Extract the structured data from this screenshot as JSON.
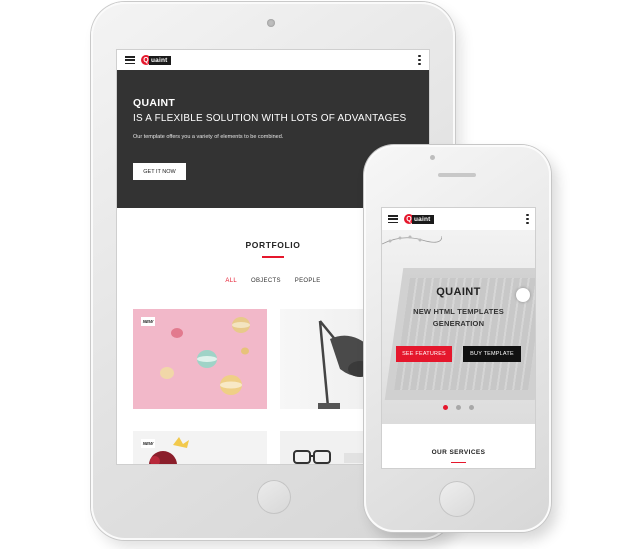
{
  "tablet": {
    "logo": {
      "mark": "Q",
      "text": "uaint"
    },
    "hero": {
      "title": "QUAINT",
      "subtitle": "IS A FLEXIBLE SOLUTION WITH LOTS OF ADVANTAGES",
      "description": "Our template offers you a variety of elements to be combined.",
      "button_label": "GET IT NOW"
    },
    "portfolio": {
      "title": "PORTFOLIO",
      "filters": [
        {
          "label": "ALL",
          "active": true
        },
        {
          "label": "OBJECTS",
          "active": false
        },
        {
          "label": "PEOPLE",
          "active": false
        }
      ],
      "badge": "NEW"
    }
  },
  "phone": {
    "logo": {
      "mark": "Q",
      "text": "uaint"
    },
    "hero": {
      "title": "QUAINT",
      "subtitle": "NEW HTML TEMPLATES GENERATION",
      "features_button": "SEE FEATURES",
      "buy_button": "BUY TEMPLATE",
      "slide_count": 3,
      "active_slide": 1
    },
    "services_title": "OUR SERVICES"
  },
  "colors": {
    "accent": "#e5172c",
    "hero_dark": "#333333",
    "text_dark": "#222222"
  }
}
